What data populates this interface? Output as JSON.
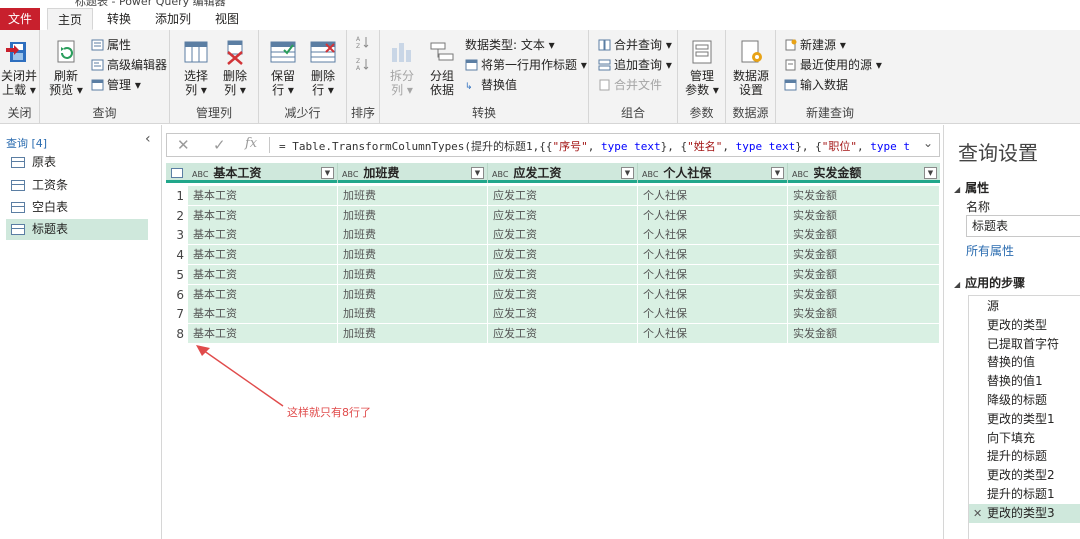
{
  "window": {
    "title": "标题表 - Power Query 编辑器"
  },
  "tabs": {
    "file": "文件",
    "home": "主页",
    "transform": "转换",
    "add_column": "添加列",
    "view": "视图"
  },
  "ribbon": {
    "close": {
      "close_load": "关闭并\n上载",
      "close_load_l1": "关闭并",
      "close_load_l2": "上载 ▾",
      "group": "关闭"
    },
    "query": {
      "refresh_l1": "刷新",
      "refresh_l2": "预览 ▾",
      "properties": "属性",
      "advanced_editor": "高级编辑器",
      "manage": "管理 ▾",
      "group": "查询"
    },
    "manage_columns": {
      "choose_l1": "选择",
      "choose_l2": "列 ▾",
      "remove_l1": "删除",
      "remove_l2": "列 ▾",
      "group": "管理列"
    },
    "reduce_rows": {
      "keep_l1": "保留",
      "keep_l2": "行 ▾",
      "remove_l1": "删除",
      "remove_l2": "行 ▾",
      "group": "减少行"
    },
    "sort": {
      "group": "排序"
    },
    "transform": {
      "split_l1": "拆分",
      "split_l2": "列 ▾",
      "group_by_l1": "分组",
      "group_by_l2": "依据",
      "data_type": "数据类型: 文本 ▾",
      "use_first_row": "将第一行用作标题 ▾",
      "replace_values": "替换值",
      "group": "转换"
    },
    "combine": {
      "merge_queries": "合并查询 ▾",
      "append_queries": "追加查询 ▾",
      "combine_files": "合并文件",
      "group": "组合"
    },
    "parameters": {
      "manage_l1": "管理",
      "manage_l2": "参数 ▾",
      "group": "参数"
    },
    "data_sources": {
      "settings_l1": "数据源",
      "settings_l2": "设置",
      "group": "数据源"
    },
    "new_query": {
      "new_source": "新建源 ▾",
      "recent_sources": "最近使用的源 ▾",
      "enter_data": "输入数据",
      "group": "新建查询"
    }
  },
  "queries_pane": {
    "header": "查询 [4]",
    "collapse": "‹",
    "items": [
      "原表",
      "工资条",
      "空白表",
      "标题表"
    ],
    "selected_index": 3
  },
  "formula_bar": {
    "cancel": "✕",
    "commit": "✓",
    "fx": "fx",
    "p1": "= Table.TransformColumnTypes(提升的标题1,{{",
    "s1": "\"序号\"",
    "p2": ", ",
    "k1": "type text",
    "p3": "}, {",
    "s2": "\"姓名\"",
    "p4": ", ",
    "k2": "type text",
    "p5": "}, {",
    "s3": "\"职位\"",
    "p6": ", ",
    "k3": "type text",
    "p7": "},",
    "expand": "⌄"
  },
  "grid": {
    "type_icon": "ABC",
    "filter_glyph": "▼",
    "columns": [
      "基本工资",
      "加班费",
      "应发工资",
      "个人社保",
      "实发金额"
    ],
    "rows": [
      [
        "1",
        "基本工资",
        "加班费",
        "应发工资",
        "个人社保",
        "实发金额"
      ],
      [
        "2",
        "基本工资",
        "加班费",
        "应发工资",
        "个人社保",
        "实发金额"
      ],
      [
        "3",
        "基本工资",
        "加班费",
        "应发工资",
        "个人社保",
        "实发金额"
      ],
      [
        "4",
        "基本工资",
        "加班费",
        "应发工资",
        "个人社保",
        "实发金额"
      ],
      [
        "5",
        "基本工资",
        "加班费",
        "应发工资",
        "个人社保",
        "实发金额"
      ],
      [
        "6",
        "基本工资",
        "加班费",
        "应发工资",
        "个人社保",
        "实发金额"
      ],
      [
        "7",
        "基本工资",
        "加班费",
        "应发工资",
        "个人社保",
        "实发金额"
      ],
      [
        "8",
        "基本工资",
        "加班费",
        "应发工资",
        "个人社保",
        "实发金额"
      ]
    ]
  },
  "annotation": {
    "text": "这样就只有8行了",
    "color": "#e04b4b"
  },
  "query_settings": {
    "title": "查询设置",
    "properties_header": "属性",
    "name_label": "名称",
    "name_value": "标题表",
    "all_properties": "所有属性",
    "applied_steps_header": "应用的步骤",
    "steps": [
      "源",
      "更改的类型",
      "已提取首字符",
      "替换的值",
      "替换的值1",
      "降级的标题",
      "更改的类型1",
      "向下填充",
      "提升的标题",
      "更改的类型2",
      "提升的标题1",
      "更改的类型3"
    ],
    "selected_step_index": 11,
    "delete_glyph": "✕"
  },
  "colors": {
    "accent_green": "#21a78b",
    "file_tab": "#c8202d",
    "selected_bg": "#cfe8dc",
    "link": "#2b6cb0"
  }
}
